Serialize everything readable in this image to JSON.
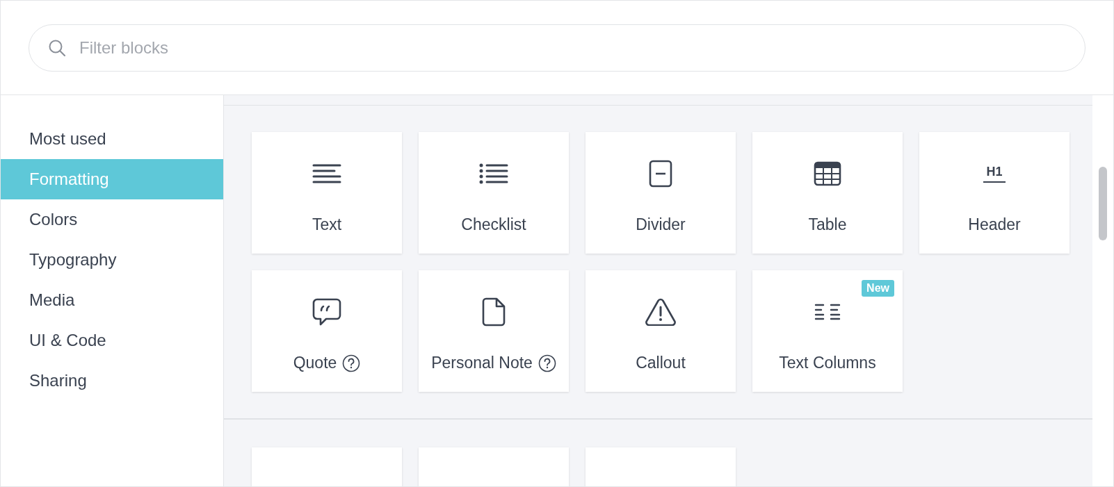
{
  "search": {
    "placeholder": "Filter blocks"
  },
  "sidebar": {
    "items": [
      {
        "label": "Most used",
        "selected": false
      },
      {
        "label": "Formatting",
        "selected": true
      },
      {
        "label": "Colors",
        "selected": false
      },
      {
        "label": "Typography",
        "selected": false
      },
      {
        "label": "Media",
        "selected": false
      },
      {
        "label": "UI & Code",
        "selected": false
      },
      {
        "label": "Sharing",
        "selected": false
      }
    ]
  },
  "blocks": [
    {
      "label": "Text",
      "kind": "text",
      "help": false
    },
    {
      "label": "Checklist",
      "kind": "checklist",
      "help": false
    },
    {
      "label": "Divider",
      "kind": "divider",
      "help": false
    },
    {
      "label": "Table",
      "kind": "table",
      "help": false
    },
    {
      "label": "Header",
      "kind": "header",
      "icon_text": "H1",
      "help": false
    },
    {
      "label": "Quote",
      "kind": "quote",
      "help": true
    },
    {
      "label": "Personal Note",
      "kind": "note",
      "help": true
    },
    {
      "label": "Callout",
      "kind": "callout",
      "help": false
    },
    {
      "label": "Text Columns",
      "kind": "columns",
      "help": false,
      "badge": "New"
    }
  ]
}
